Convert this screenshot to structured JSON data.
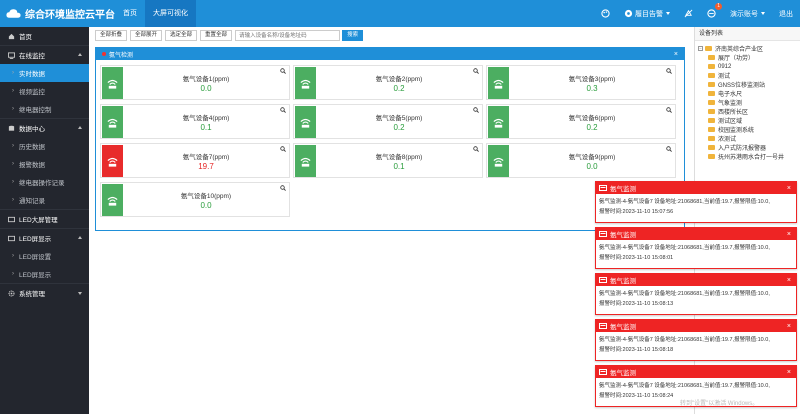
{
  "header": {
    "title": "综合环境监控云平台",
    "nav": [
      "首页",
      "大屏可视化"
    ],
    "active_nav": 1,
    "right": {
      "alarm_label": "履目告警",
      "notification_count": "1",
      "user_label": "演示账号",
      "logout_label": "退出"
    }
  },
  "sidebar": {
    "items": [
      {
        "label": "首页",
        "type": "group",
        "icon": "home-icon"
      },
      {
        "label": "在线监控",
        "type": "group",
        "icon": "monitor-icon",
        "expanded": true
      },
      {
        "label": "实时数据",
        "type": "sub",
        "active": true
      },
      {
        "label": "视频监控",
        "type": "sub"
      },
      {
        "label": "继电器控制",
        "type": "sub"
      },
      {
        "label": "数据中心",
        "type": "group",
        "icon": "database-icon",
        "expanded": true
      },
      {
        "label": "历史数据",
        "type": "sub"
      },
      {
        "label": "报警数据",
        "type": "sub"
      },
      {
        "label": "继电器操作记录",
        "type": "sub"
      },
      {
        "label": "通知记录",
        "type": "sub"
      },
      {
        "label": "LED大屏管理",
        "type": "group",
        "icon": "led-icon"
      },
      {
        "label": "LED屏显示",
        "type": "group",
        "icon": "led-icon",
        "expanded": true
      },
      {
        "label": "LED屏设置",
        "type": "sub"
      },
      {
        "label": "LED屏显示",
        "type": "sub"
      },
      {
        "label": "系统管理",
        "type": "group",
        "icon": "gear-icon",
        "collapsed": true
      }
    ]
  },
  "toolbar": {
    "buttons": [
      "全部折叠",
      "全部展开",
      "选定全部",
      "重置全部"
    ],
    "search_placeholder": "请输入设备名称/设备地址码",
    "search_label": "搜索"
  },
  "panel": {
    "title": "氨气检测",
    "close": "×"
  },
  "devices": [
    {
      "name": "氨气设备1(ppm)",
      "value": "0.0",
      "alarm": false
    },
    {
      "name": "氨气设备2(ppm)",
      "value": "0.2",
      "alarm": false
    },
    {
      "name": "氨气设备3(ppm)",
      "value": "0.3",
      "alarm": false
    },
    {
      "name": "氨气设备4(ppm)",
      "value": "0.1",
      "alarm": false
    },
    {
      "name": "氨气设备5(ppm)",
      "value": "0.2",
      "alarm": false
    },
    {
      "name": "氨气设备6(ppm)",
      "value": "0.2",
      "alarm": false
    },
    {
      "name": "氨气设备7(ppm)",
      "value": "19.7",
      "alarm": true
    },
    {
      "name": "氨气设备8(ppm)",
      "value": "0.1",
      "alarm": false
    },
    {
      "name": "氨气设备9(ppm)",
      "value": "0.0",
      "alarm": false
    },
    {
      "name": "氨气设备10(ppm)",
      "value": "0.0",
      "alarm": false
    }
  ],
  "device_tree": {
    "title": "设备列表",
    "root": "济南英综合产业区",
    "children": [
      "展厅（功劳）",
      "0912",
      "测试",
      "GNSS位移监测站",
      "电子水尺",
      "气象监测",
      "西楼所长区",
      "测试区域",
      "校园监测系统",
      "浓测试",
      "入户式防汛报警器",
      "抚州苏港雨水合打一号井"
    ]
  },
  "alerts": [
    {
      "title": "氨气监测",
      "line1": "氨气监测-4-氨气设备7 设备地址:21068681,当前值:19.7,报警限值:10.0,",
      "line2": "报警时间:2023-11-10 15:07:56"
    },
    {
      "title": "氨气监测",
      "line1": "氨气监测-4-氨气设备7 设备地址:21068681,当前值:19.7,报警限值:10.0,",
      "line2": "报警时间:2023-11-10 15:08:01"
    },
    {
      "title": "氨气监测",
      "line1": "氨气监测-4-氨气设备7 设备地址:21068681,当前值:19.7,报警限值:10.0,",
      "line2": "报警时间:2023-11-10 15:08:13"
    },
    {
      "title": "氨气监测",
      "line1": "氨气监测-4-氨气设备7 设备地址:21068681,当前值:19.7,报警限值:10.0,",
      "line2": "报警时间:2023-11-10 15:08:18"
    },
    {
      "title": "氨气监测",
      "line1": "氨气监测-4-氨气设备7 设备地址:21068681,当前值:19.7,报警限值:10.0,",
      "line2": "报警时间:2023-11-10 15:08:24"
    }
  ],
  "watermark": "转到\"设置\"以激活 Windows。",
  "colors": {
    "header": "#1f8fd8",
    "sidebar": "#23262e",
    "normal": "#4cae61",
    "alarm": "#e82b2b"
  }
}
